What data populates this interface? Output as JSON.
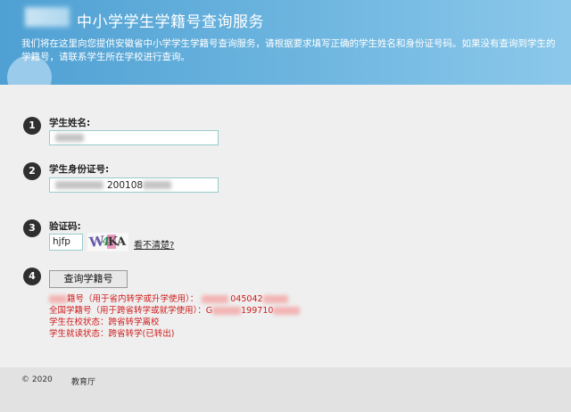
{
  "header": {
    "title": "中小学学生学籍号查询服务",
    "intro": "我们将在这里向您提供安徽省中小学学生学籍号查询服务，请根据要求填写正确的学生姓名和身份证号码。如果没有查询到学生的学籍号，请联系学生所在学校进行查询。"
  },
  "steps": {
    "s1": "1",
    "s2": "2",
    "s3": "3",
    "s4": "4"
  },
  "form": {
    "name_label": "学生姓名:",
    "id_label": "学生身份证号:",
    "id_visible_part": "200108",
    "captcha_label": "验证码:",
    "captcha_value": "hjfp",
    "captcha_refresh_link": "看不清楚?",
    "captcha_chars": [
      "W",
      "4",
      "K",
      "A"
    ],
    "submit_label": "查询学籍号"
  },
  "results": {
    "line1_label": "籍号（用于省内转学或升学使用）：",
    "line1_value": "045042",
    "line2_label": "全国学籍号（用于跨省转学或就学使用）：",
    "line2_prefix": "G",
    "line2_value": "199710",
    "line3": "学生在校状态：跨省转学离校",
    "line4": "学生就读状态：跨省转学(已转出)"
  },
  "footer": {
    "copyright": "© 2020",
    "org": "教育厅"
  },
  "colors": {
    "header_blue": "#4fa0d3",
    "result_red": "#d11b1b",
    "background": "#efefef"
  }
}
